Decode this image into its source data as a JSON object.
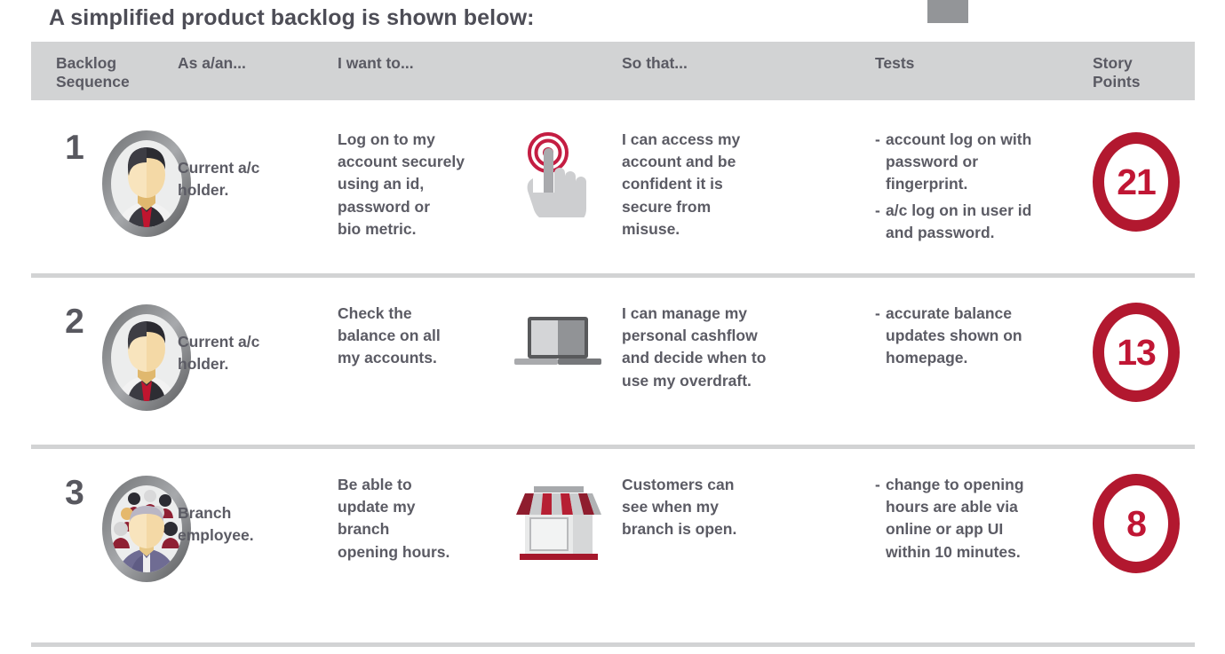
{
  "page": {
    "title": "A simplified product backlog is shown below:",
    "accent_red": "#b2182f",
    "header_band_color": "#d2d3d4",
    "text_color": "#5b5b64",
    "marker_color": "#939598"
  },
  "table": {
    "columns": [
      {
        "key": "sequence",
        "label": "Backlog\nSequence"
      },
      {
        "key": "as_a",
        "label": "As a/an..."
      },
      {
        "key": "i_want_to",
        "label": "I want to..."
      },
      {
        "key": "so_that",
        "label": "So that..."
      },
      {
        "key": "tests",
        "label": "Tests"
      },
      {
        "key": "story_points",
        "label": "Story\nPoints"
      }
    ],
    "rows": [
      {
        "sequence": "1",
        "persona_icon": "businessman-avatar-icon",
        "as_a": "Current a/c\nholder.",
        "i_want_to": "Log on to my\naccount securely\nusing an id,\npassword or\nbio metric.",
        "want_icon": "touch-fingerprint-icon",
        "so_that": "I can access my\naccount and be\nconfident it is\nsecure from\nmisuse.",
        "tests": [
          "account log on with\npassword or\nfingerprint.",
          "a/c log on in user id\nand password."
        ],
        "story_points": "21"
      },
      {
        "sequence": "2",
        "persona_icon": "businessman-avatar-icon",
        "as_a": "Current a/c\nholder.",
        "i_want_to": "Check the\nbalance on all\nmy accounts.",
        "want_icon": "laptop-icon",
        "so_that": "I can manage my\npersonal cashflow\nand decide when to\nuse my overdraft.",
        "tests": [
          "accurate balance\nupdates shown on\nhomepage."
        ],
        "story_points": "13"
      },
      {
        "sequence": "3",
        "persona_icon": "group-people-avatar-icon",
        "as_a": "Branch\nemployee.",
        "i_want_to": "Be able to\nupdate my\nbranch\nopening hours.",
        "want_icon": "shop-storefront-icon",
        "so_that": "Customers can\nsee when my\nbranch is open.",
        "tests": [
          "change to opening\nhours are able via\nonline or app UI\nwithin 10 minutes."
        ],
        "story_points": "8"
      }
    ],
    "test_bullet_prefix": "-"
  }
}
